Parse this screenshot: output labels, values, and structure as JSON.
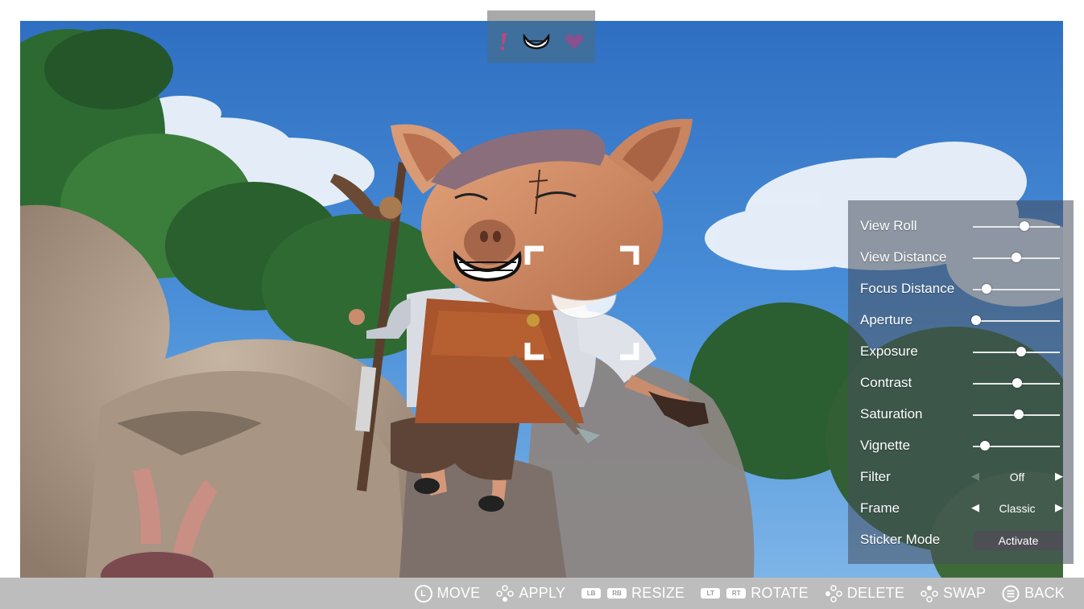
{
  "sticker_bar": {
    "stickers": [
      "exclamation-sticker",
      "grin-sticker",
      "heart-sticker"
    ],
    "tray_color": "#3f6f9d",
    "heart_color": "#8a4f8f",
    "exclaim_color": "#c0457a"
  },
  "settings": {
    "view_roll": {
      "label": "View Roll",
      "value": 0.59
    },
    "view_distance": {
      "label": "View Distance",
      "value": 0.5
    },
    "focus_distance": {
      "label": "Focus Distance",
      "value": 0.16
    },
    "aperture": {
      "label": "Aperture",
      "value": 0.04
    },
    "exposure": {
      "label": "Exposure",
      "value": 0.56
    },
    "contrast": {
      "label": "Contrast",
      "value": 0.51
    },
    "saturation": {
      "label": "Saturation",
      "value": 0.53
    },
    "vignette": {
      "label": "Vignette",
      "value": 0.14
    },
    "filter": {
      "label": "Filter",
      "value": "Off"
    },
    "frame": {
      "label": "Frame",
      "value": "Classic"
    },
    "sticker_mode": {
      "label": "Sticker Mode",
      "button": "Activate"
    }
  },
  "hints": {
    "move": {
      "key": "L",
      "label": "MOVE"
    },
    "apply": {
      "label": "APPLY"
    },
    "resize": {
      "key1": "LB",
      "key2": "RB",
      "label": "RESIZE"
    },
    "rotate": {
      "key1": "LT",
      "key2": "RT",
      "label": "ROTATE"
    },
    "delete": {
      "label": "DELETE"
    },
    "swap": {
      "label": "SWAP"
    },
    "back": {
      "label": "BACK"
    }
  }
}
